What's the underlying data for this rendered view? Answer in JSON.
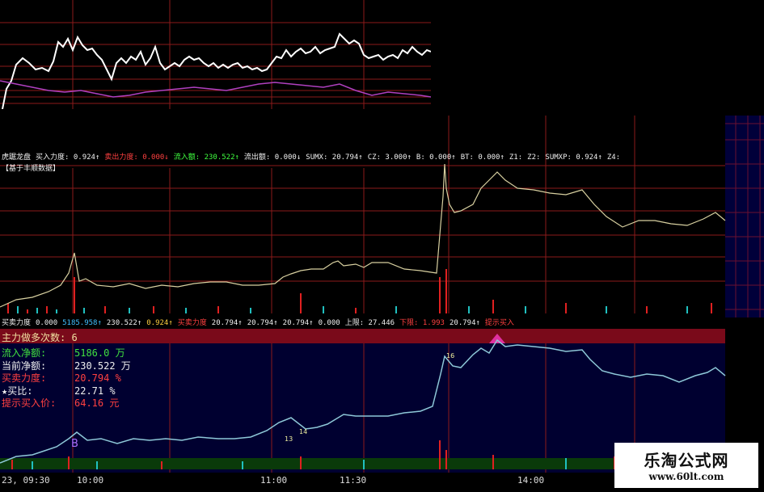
{
  "colors": {
    "bg": "#000000",
    "grid": "#8b1a1a",
    "navy": "#00003a",
    "white_line": "#ffffff",
    "purple_line": "#b040c0",
    "beige_line": "#d8d0a0",
    "cyan_line": "#8ec8d8",
    "red": "#e02020",
    "teal": "#20c0c0"
  },
  "panel2": {
    "status": [
      {
        "text": "虎踞龙盘",
        "color": "#f0f0f0"
      },
      {
        "text": "买入力度: 0.924↑",
        "color": "#f0f0f0"
      },
      {
        "text": "卖出力度: 0.000↓",
        "color": "#ff4040"
      },
      {
        "text": "流入额: 230.522↑",
        "color": "#40ff40"
      },
      {
        "text": "流出额: 0.000↓",
        "color": "#f0f0f0"
      },
      {
        "text": "SUMX: 20.794↑",
        "color": "#f0f0f0"
      },
      {
        "text": "CZ: 3.000↑",
        "color": "#f0f0f0"
      },
      {
        "text": "B: 0.000↑",
        "color": "#f0f0f0"
      },
      {
        "text": "BT: 0.000↑",
        "color": "#f0f0f0"
      },
      {
        "text": "Z1:",
        "color": "#f0f0f0"
      },
      {
        "text": "Z2:",
        "color": "#f0f0f0"
      },
      {
        "text": "SUMXP: 0.924↑",
        "color": "#f0f0f0"
      },
      {
        "text": "Z4:",
        "color": "#f0f0f0"
      }
    ],
    "subtitle": "【基于丰顺数据】"
  },
  "panel3": {
    "status": [
      {
        "text": "买卖力度",
        "color": "#f0f0f0"
      },
      {
        "text": "0.000",
        "color": "#f0f0f0"
      },
      {
        "text": "5185.958↑",
        "color": "#40c0ff"
      },
      {
        "text": "230.522↑",
        "color": "#f0f0f0"
      },
      {
        "text": "0.924↑",
        "color": "#ffd040"
      },
      {
        "text": "买卖力度",
        "color": "#ff4040"
      },
      {
        "text": "20.794↑",
        "color": "#f0f0f0"
      },
      {
        "text": "20.794↑",
        "color": "#f0f0f0"
      },
      {
        "text": "20.794↑",
        "color": "#f0f0f0"
      },
      {
        "text": "0.000",
        "color": "#f0f0f0"
      },
      {
        "text": "上限: 27.446",
        "color": "#f0f0f0"
      },
      {
        "text": "下限: 1.993",
        "color": "#ff4040"
      },
      {
        "text": "20.794↑",
        "color": "#f0f0f0"
      },
      {
        "text": "提示买入",
        "color": "#ff4040"
      }
    ],
    "header": "主力做多次数:  6",
    "info": [
      {
        "label": "流入净额:",
        "value": "5186.0  万",
        "color": "#40e040"
      },
      {
        "label": "当前净额:",
        "value": "230.522  万",
        "color": "#f0f0f0"
      },
      {
        "label": "买卖力度:",
        "value": "20.794  %",
        "color": "#ff4040"
      },
      {
        "label": "★买比:",
        "value": "22.71  %",
        "color": "#f0f0f0"
      },
      {
        "label": "提示买入价:",
        "value": "64.16  元",
        "color": "#ff4040"
      }
    ],
    "markers": {
      "b": "B",
      "t1": "13",
      "t2": "14",
      "t3": "16"
    }
  },
  "timeaxis": {
    "labels": [
      "23, 09:30",
      "10:00",
      "11:00",
      "11:30",
      "14:00"
    ]
  },
  "watermark": {
    "title": "乐淘公式网",
    "url": "www.60lt.com"
  }
}
